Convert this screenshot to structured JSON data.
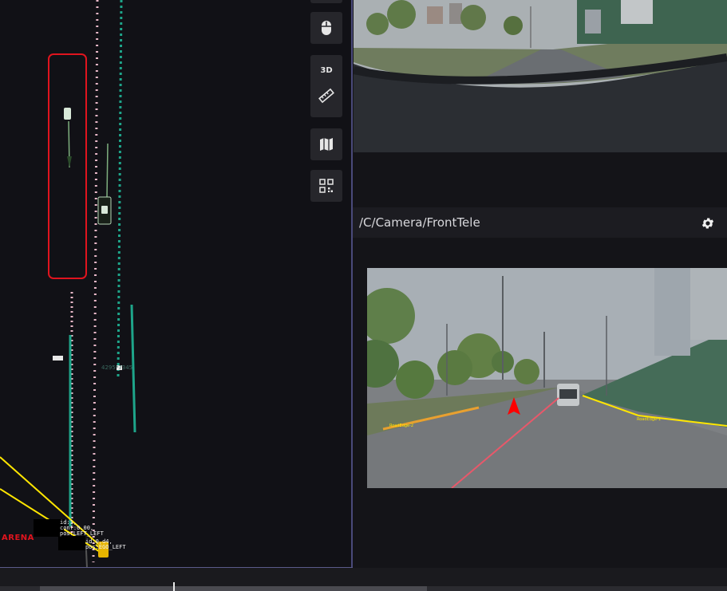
{
  "toolbar": {
    "top_icon": "cube-icon",
    "mouse_icon": "mouse-icon",
    "mode_3d_label": "3D",
    "ruler_icon": "ruler-icon",
    "map_icon": "map-icon",
    "qr_icon": "qr-icon"
  },
  "scene": {
    "id_label": "4295*7345",
    "brand": "ARENA",
    "info_block_1": "id:1,\nconf:0.00,\npos:LEFT_LEFT",
    "info_block_2": "id:0,d4,\npos:EGO_LEFT"
  },
  "camera_panel": {
    "title": "/C/Camera/FrontTele",
    "settings_icon": "gear-icon"
  },
  "tele_camera": {
    "lane_label_left": "RoadEdge-2",
    "lane_label_right": "RoadEdge-1"
  },
  "colors": {
    "accent_red": "#e0141e",
    "lane_yellow": "#ffe600",
    "lane_teal": "#1ea58a",
    "lane_pink": "#e8b8c8"
  }
}
